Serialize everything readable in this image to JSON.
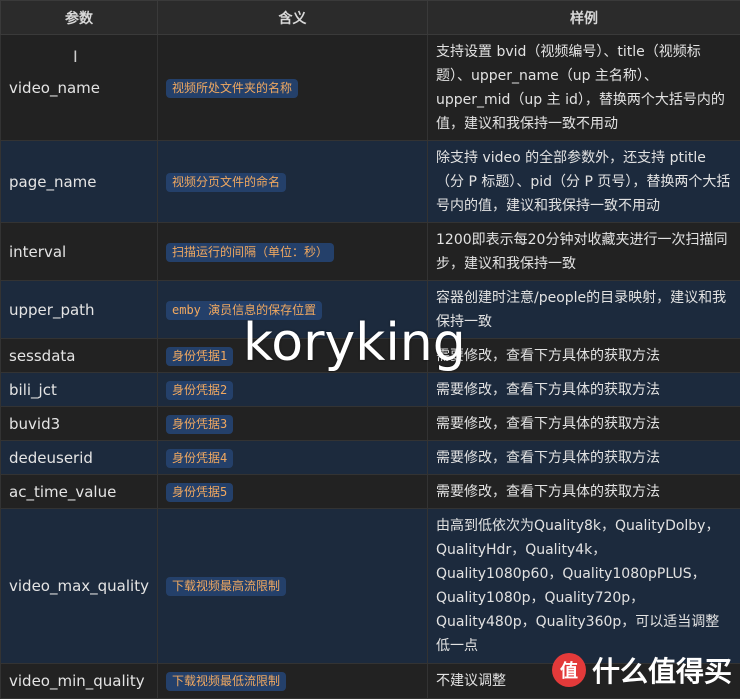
{
  "headers": [
    "参数",
    "含义",
    "样例"
  ],
  "rows": [
    {
      "param": "video_name",
      "meaning": "视频所处文件夹的名称",
      "example": "支持设置 bvid（视频编号）、title（视频标题）、upper_name（up 主名称）、upper_mid（up 主 id），替换两个大括号内的值，建议和我保持一致不用动"
    },
    {
      "param": "page_name",
      "meaning": "视频分页文件的命名",
      "example": "除支持 video 的全部参数外，还支持 ptitle（分 P 标题）、pid（分 P 页号），替换两个大括号内的值，建议和我保持一致不用动"
    },
    {
      "param": "interval",
      "meaning": "扫描运行的间隔（单位：秒）",
      "example": "1200即表示每20分钟对收藏夹进行一次扫描同步，建议和我保持一致"
    },
    {
      "param": "upper_path",
      "meaning": "emby 演员信息的保存位置",
      "example": "容器创建时注意/people的目录映射，建议和我保持一致"
    },
    {
      "param": "sessdata",
      "meaning": "身份凭据1",
      "example": "需要修改，查看下方具体的获取方法"
    },
    {
      "param": "bili_jct",
      "meaning": "身份凭据2",
      "example": "需要修改，查看下方具体的获取方法"
    },
    {
      "param": "buvid3",
      "meaning": "身份凭据3",
      "example": "需要修改，查看下方具体的获取方法"
    },
    {
      "param": "dedeuserid",
      "meaning": "身份凭据4",
      "example": "需要修改，查看下方具体的获取方法"
    },
    {
      "param": "ac_time_value",
      "meaning": "身份凭据5",
      "example": "需要修改，查看下方具体的获取方法"
    },
    {
      "param": "video_max_quality",
      "meaning": "下载视频最高流限制",
      "example": "由高到低依次为Quality8k，QualityDolby，QualityHdr，Quality4k，Quality1080p60，Quality1080pPLUS，Quality1080p，Quality720p，Quality480p，Quality360p，可以适当调整低一点"
    },
    {
      "param": "video_min_quality",
      "meaning": "下载视频最低流限制",
      "example": "不建议调整"
    }
  ],
  "watermark": "koryking",
  "logo": {
    "icon": "值",
    "text": "什么值得买"
  }
}
